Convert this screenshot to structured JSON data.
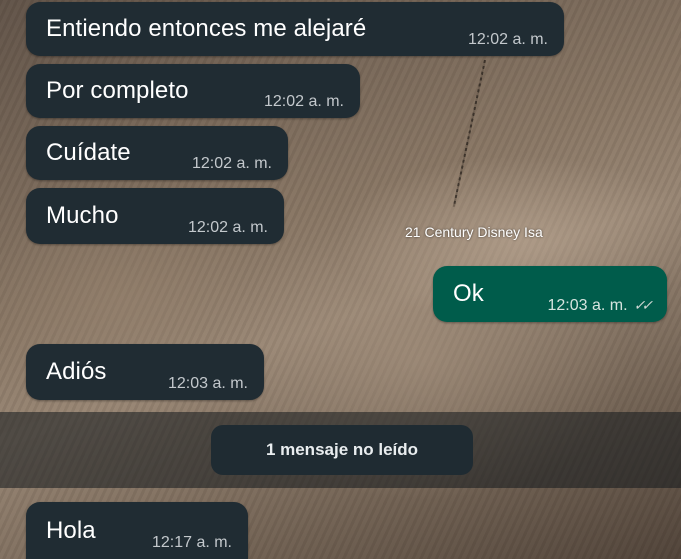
{
  "watermark": "21 Century Disney Isa",
  "messages": [
    {
      "text": "Entiendo entonces me alejaré",
      "time": "12:02 a. m."
    },
    {
      "text": "Por completo",
      "time": "12:02 a. m."
    },
    {
      "text": "Cuídate",
      "time": "12:02 a. m."
    },
    {
      "text": "Mucho",
      "time": "12:02 a. m."
    },
    {
      "text": "Ok",
      "time": "12:03 a. m.",
      "ticks": "✓✓"
    },
    {
      "text": "Adiós",
      "time": "12:03 a. m."
    },
    {
      "text": "Hola",
      "time": "12:17 a. m."
    }
  ],
  "unread_banner": "1 mensaje no leído",
  "colors": {
    "incoming_bubble": "#202c33",
    "outgoing_bubble": "#005c4b",
    "timestamp": "#c3c8cc"
  }
}
